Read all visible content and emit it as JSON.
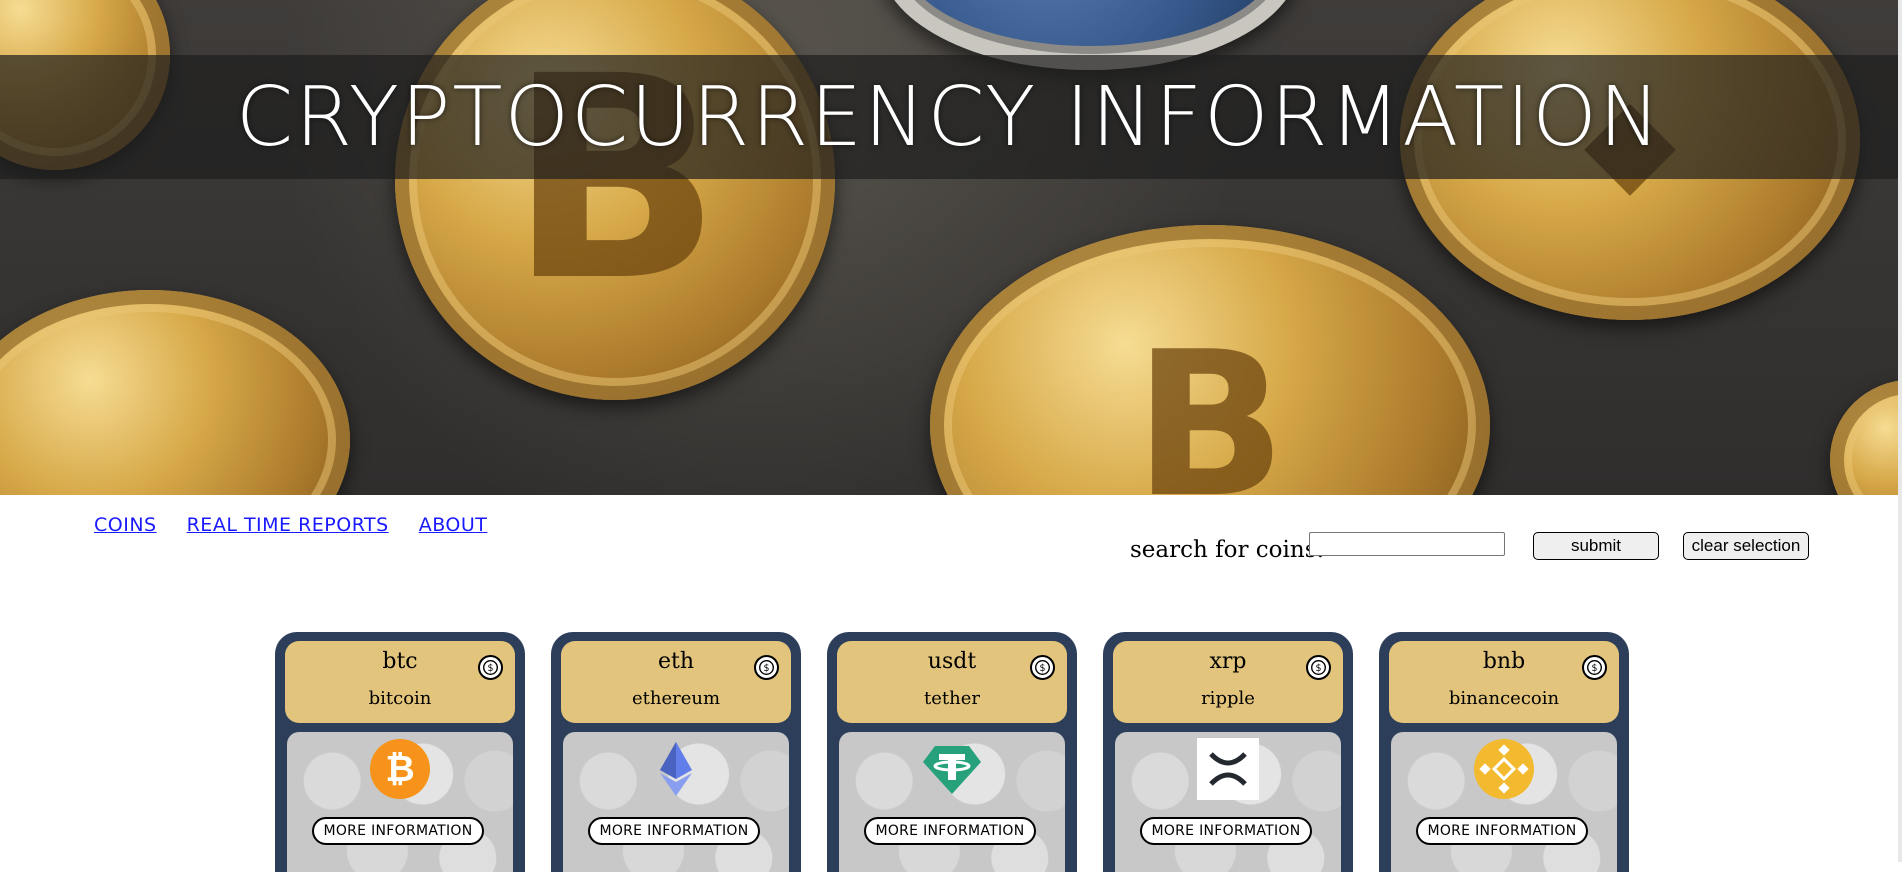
{
  "header": {
    "title": "CRYPTOCURRENCY INFORMATION"
  },
  "nav": [
    {
      "label": "COINS"
    },
    {
      "label": "REAL TIME REPORTS"
    },
    {
      "label": "ABOUT"
    }
  ],
  "search": {
    "label": "search for coins:",
    "value": "",
    "submit_label": "submit",
    "clear_label": "clear selection"
  },
  "cards": [
    {
      "symbol": "btc",
      "name": "bitcoin",
      "logo": "bitcoin-logo-icon",
      "logo_color": "#f7931a",
      "button": "MORE INFORMATION"
    },
    {
      "symbol": "eth",
      "name": "ethereum",
      "logo": "ethereum-logo-icon",
      "logo_color": "#627eea",
      "button": "MORE INFORMATION"
    },
    {
      "symbol": "usdt",
      "name": "tether",
      "logo": "tether-logo-icon",
      "logo_color": "#26a17b",
      "button": "MORE INFORMATION"
    },
    {
      "symbol": "xrp",
      "name": "ripple",
      "logo": "ripple-logo-icon",
      "logo_color": "#23292f",
      "button": "MORE INFORMATION"
    },
    {
      "symbol": "bnb",
      "name": "binancecoin",
      "logo": "bnb-logo-icon",
      "logo_color": "#f3ba2f",
      "button": "MORE INFORMATION"
    }
  ],
  "colors": {
    "card_bg": "#2c3e5a",
    "card_head": "#e2c47d",
    "link": "#1a1aff"
  }
}
